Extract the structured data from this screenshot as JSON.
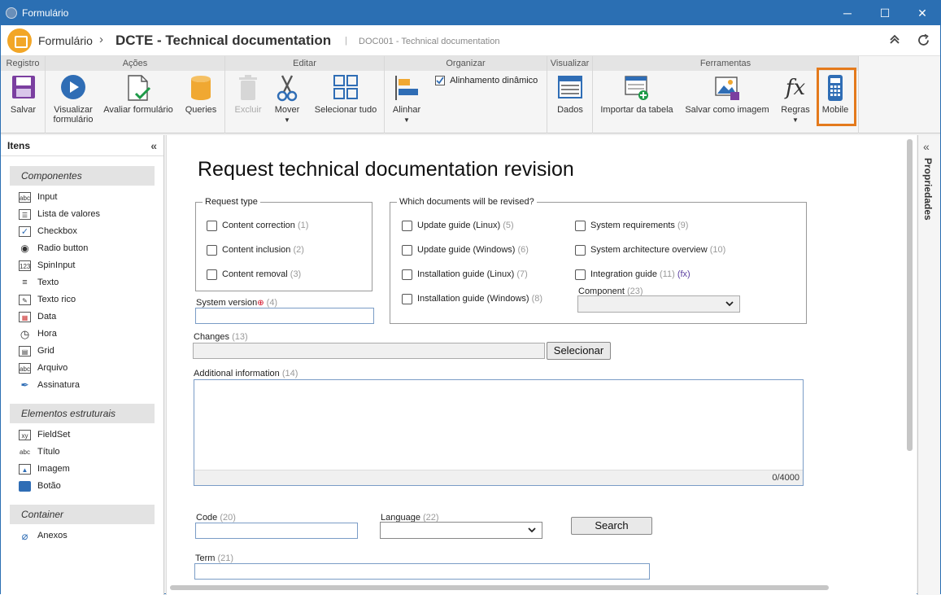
{
  "window": {
    "title": "Formulário",
    "minimize": "─",
    "maximize": "☐",
    "close": "✕"
  },
  "header": {
    "crumb_module": "Formulário",
    "crumb_sep": "›",
    "crumb_title": "DCTE - Technical documentation",
    "crumb_divider": "|",
    "crumb_sub": "DOC001 - Technical documentation",
    "collapse_icon": "chevron-double-up-icon",
    "refresh_icon": "refresh-icon"
  },
  "ribbon": {
    "groups": {
      "registro": "Registro",
      "acoes": "Ações",
      "editar": "Editar",
      "organizar": "Organizar",
      "visualizar": "Visualizar",
      "ferramentas": "Ferramentas"
    },
    "buttons": {
      "salvar": "Salvar",
      "visualizar_formulario": "Visualizar formulário",
      "avaliar_formulario": "Avaliar formulário",
      "queries": "Queries",
      "excluir": "Excluir",
      "mover": "Mover",
      "selecionar_tudo": "Selecionar tudo",
      "alinhar": "Alinhar",
      "alinhamento_dinamico": "Alinhamento dinâmico",
      "dados": "Dados",
      "importar_tabela": "Importar da tabela",
      "salvar_imagem": "Salvar como imagem",
      "regras": "Regras",
      "mobile": "Mobile"
    },
    "alinhamento_checked": true,
    "caret": "▼"
  },
  "items_panel": {
    "title": "Itens",
    "collapse": "«",
    "sections": {
      "componentes": "Componentes",
      "estruturais": "Elementos estruturais",
      "container": "Container"
    },
    "componentes": [
      "Input",
      "Lista de valores",
      "Checkbox",
      "Radio button",
      "SpinInput",
      "Texto",
      "Texto rico",
      "Data",
      "Hora",
      "Grid",
      "Arquivo",
      "Assinatura"
    ],
    "estruturais": [
      "FieldSet",
      "Título",
      "Imagem",
      "Botão"
    ],
    "container": [
      "Anexos"
    ]
  },
  "form": {
    "title": "Request technical documentation revision",
    "request_type": {
      "legend": "Request type",
      "options": [
        {
          "label": "Content correction",
          "num": "(1)"
        },
        {
          "label": "Content inclusion",
          "num": "(2)"
        },
        {
          "label": "Content removal",
          "num": "(3)"
        }
      ]
    },
    "system_version": {
      "label": "System version",
      "required": "⊕",
      "num": "(4)"
    },
    "docs_revised": {
      "legend": "Which documents will be revised?",
      "col1": [
        {
          "label": "Update guide (Linux)",
          "num": "(5)"
        },
        {
          "label": "Update guide (Windows)",
          "num": "(6)"
        },
        {
          "label": "Installation guide (Linux)",
          "num": "(7)"
        },
        {
          "label": "Installation guide (Windows)",
          "num": "(8)"
        }
      ],
      "col2": [
        {
          "label": "System requirements",
          "num": "(9)"
        },
        {
          "label": "System architecture overview",
          "num": "(10)"
        },
        {
          "label": "Integration guide",
          "num": "(11)",
          "fx": "(fx)"
        }
      ],
      "component": {
        "label": "Component",
        "num": "(23)"
      }
    },
    "changes": {
      "label": "Changes",
      "num": "(13)",
      "button": "Selecionar"
    },
    "additional": {
      "label": "Additional information",
      "num": "(14)",
      "counter": "0/4000"
    },
    "code": {
      "label": "Code",
      "num": "(20)"
    },
    "language": {
      "label": "Language",
      "num": "(22)"
    },
    "search_button": "Search",
    "term": {
      "label": "Term",
      "num": "(21)"
    }
  },
  "properties_panel": {
    "title": "Propriedades",
    "expand": "«"
  },
  "colors": {
    "titlebar": "#2b6fb3",
    "accent_highlight": "#e47a1c",
    "logo": "#f2a627",
    "ribbon_icon_blue": "#2f6db5"
  }
}
